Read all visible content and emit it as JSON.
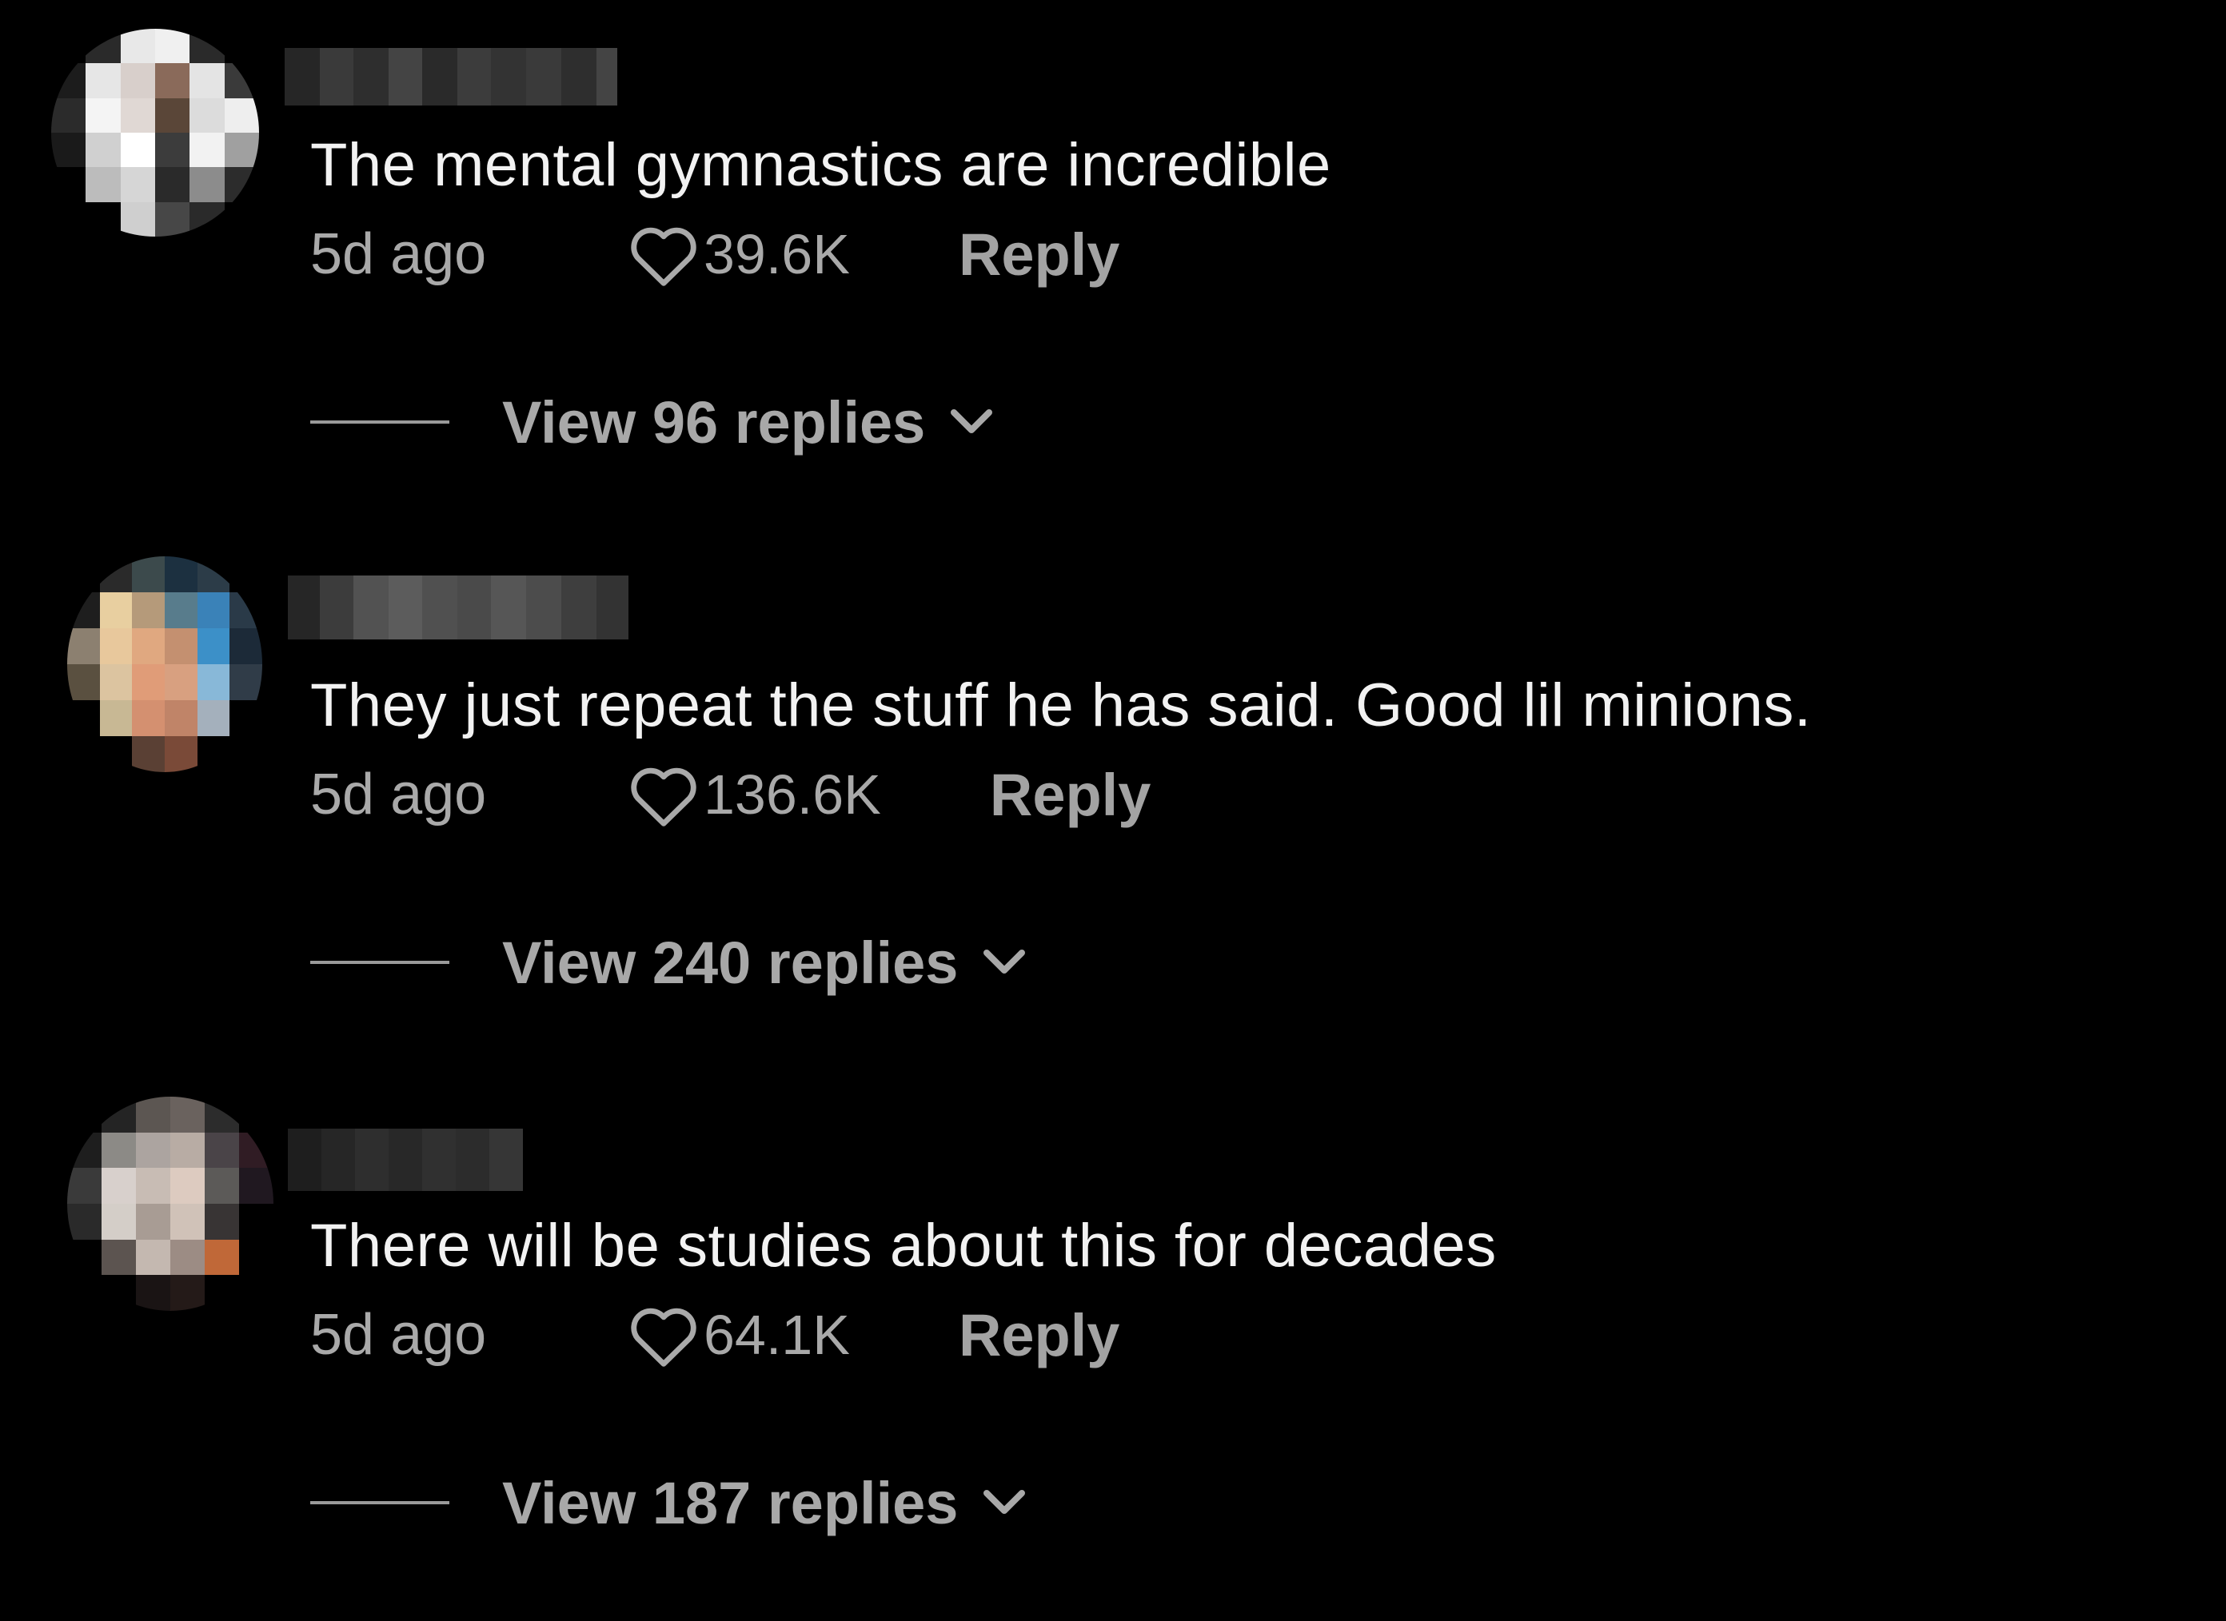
{
  "colors": {
    "background": "#000000",
    "text_primary": "#f2f2f2",
    "text_secondary": "#a9a9a9"
  },
  "comments": [
    {
      "text": "The mental gymnastics are incredible",
      "time": "5d ago",
      "likes": "39.6K",
      "reply_label": "Reply",
      "view_replies": "View 96 replies",
      "avatar_icon": "pixelated-avatar",
      "heart_icon": "heart-outline-icon",
      "chevron_icon": "chevron-down-icon"
    },
    {
      "text": "They just repeat the stuff he has said. Good lil minions.",
      "time": "5d ago",
      "likes": "136.6K",
      "reply_label": "Reply",
      "view_replies": "View 240 replies",
      "avatar_icon": "pixelated-avatar",
      "heart_icon": "heart-outline-icon",
      "chevron_icon": "chevron-down-icon"
    },
    {
      "text": "There will be studies about this for decades",
      "time": "5d ago",
      "likes": "64.1K",
      "reply_label": "Reply",
      "view_replies": "View 187 replies",
      "avatar_icon": "pixelated-avatar",
      "heart_icon": "heart-outline-icon",
      "chevron_icon": "chevron-down-icon"
    }
  ]
}
